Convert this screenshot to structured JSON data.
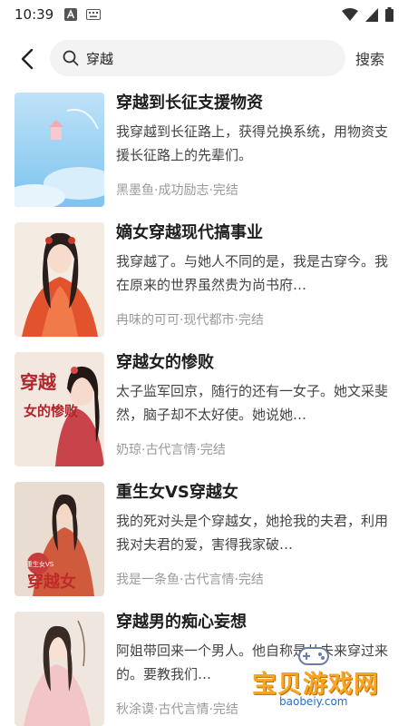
{
  "status_bar": {
    "time": "10:39"
  },
  "search": {
    "query": "穿越",
    "button_label": "搜索"
  },
  "books": [
    {
      "title": "穿越到长征支援物资",
      "desc": "我穿越到长征路上，获得兑换系统，用物资支援长征路上的先辈们。",
      "meta": "黑墨鱼·成功励志·完结"
    },
    {
      "title": "嫡女穿越现代搞事业",
      "desc": "我穿越了。与她人不同的是，我是古穿今。我在原来的世界虽然贵为尚书府…",
      "meta": "冉味的可可·现代都市·完结"
    },
    {
      "title": "穿越女的惨败",
      "desc": "太子监军回京，随行的还有一女子。她文采斐然，脑子却不太好使。她说她…",
      "meta": "奶琼·古代言情·完结"
    },
    {
      "title": "重生女VS穿越女",
      "desc": "我的死对头是个穿越女，她抢我的夫君，利用我对夫君的爱，害得我家破…",
      "meta": "我是一条鱼·古代言情·完结"
    },
    {
      "title": "穿越男的痴心妄想",
      "desc": "阿姐带回来一个男人。他自称是从未来穿过来的。要教我们…",
      "meta": "秋涂谟·古代言情·完结"
    }
  ],
  "covers": {
    "cover1": {
      "style": "sky-blue"
    },
    "cover2": {
      "style": "red-robe"
    },
    "cover3": {
      "text_a": "穿越",
      "text_b": "女的惨败"
    },
    "cover4": {
      "text_a": "重生女VS",
      "text_b": "穿越女"
    },
    "cover5": {
      "style": "pink-lady"
    }
  },
  "watermark": {
    "main": "宝贝游戏网",
    "sub": "baobeiy.com"
  },
  "icons": {
    "back": "chevron-left-icon",
    "search": "magnifier-icon",
    "wifi": "wifi-icon",
    "signal": "signal-icon",
    "battery": "battery-icon"
  }
}
